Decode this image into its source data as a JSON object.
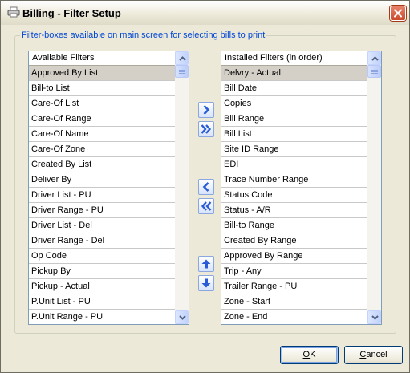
{
  "window": {
    "title": "Billing - Filter Setup"
  },
  "group": {
    "caption": "Filter-boxes available on main screen for selecting bills to print"
  },
  "available": {
    "header": "Available Filters",
    "items": [
      "Approved By List",
      "Bill-to List",
      "Care-Of List",
      "Care-Of Range",
      "Care-Of Name",
      "Care-Of Zone",
      "Created By List",
      "Deliver By",
      "Driver List - PU",
      "Driver Range - PU",
      "Driver List - Del",
      "Driver Range - Del",
      "Op Code",
      "Pickup By",
      "Pickup - Actual",
      "P.Unit List - PU",
      "P.Unit Range - PU"
    ],
    "selected_index": 0
  },
  "installed": {
    "header": "Installed Filters (in order)",
    "items": [
      "Delvry - Actual",
      "Bill Date",
      "Copies",
      "Bill Range",
      "Bill List",
      "Site ID Range",
      "EDI",
      "Trace Number Range",
      "Status Code",
      "Status - A/R",
      "Bill-to Range",
      "Created By Range",
      "Approved By Range",
      "Trip - Any",
      "Trailer Range - PU",
      "Zone - Start",
      "Zone - End"
    ],
    "selected_index": 0
  },
  "buttons": {
    "ok": {
      "before": "",
      "mnemonic": "O",
      "after": "K"
    },
    "cancel": {
      "before": "",
      "mnemonic": "C",
      "after": "ancel"
    }
  },
  "icons": {
    "move_right": "arrow-right-icon",
    "move_all_right": "double-arrow-right-icon",
    "move_left": "arrow-left-icon",
    "move_all_left": "double-arrow-left-icon",
    "move_up": "arrow-up-icon",
    "move_down": "arrow-down-icon"
  },
  "colors": {
    "accent_blue": "#0046d5",
    "arrow_blue": "#2a5bd7",
    "selection": "#d4d0c8"
  }
}
